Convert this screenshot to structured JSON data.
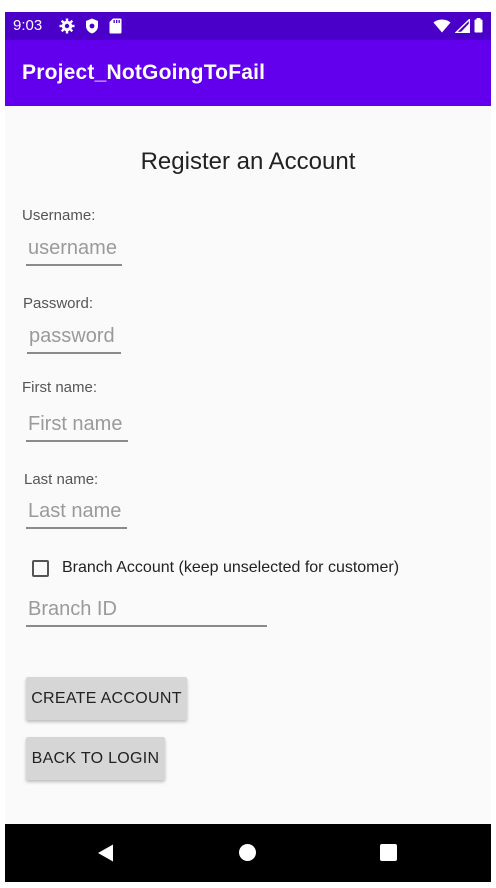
{
  "status_bar": {
    "time": "9:03",
    "icons_left": [
      "gear-icon",
      "shield-icon",
      "sd-card-icon"
    ],
    "icons_right": [
      "wifi-icon",
      "cell-signal-icon",
      "battery-icon"
    ]
  },
  "app_bar": {
    "title": "Project_NotGoingToFail"
  },
  "form": {
    "heading": "Register an Account",
    "username_label": "Username:",
    "username_placeholder": "username",
    "password_label": "Password:",
    "password_placeholder": "password",
    "first_name_label": "First name:",
    "first_name_placeholder": "First name",
    "last_name_label": "Last name:",
    "last_name_placeholder": "Last name",
    "branch_checkbox_label": "Branch Account (keep unselected for customer)",
    "branch_checkbox_checked": false,
    "branch_id_placeholder": "Branch ID"
  },
  "buttons": {
    "create_account": "CREATE ACCOUNT",
    "back_to_login": "BACK TO LOGIN"
  },
  "nav_bar": {
    "icons": [
      "back-icon",
      "home-icon",
      "recents-icon"
    ]
  },
  "colors": {
    "status_bar": "#4a00c8",
    "app_bar": "#6200ee",
    "button": "#d6d6d6"
  }
}
